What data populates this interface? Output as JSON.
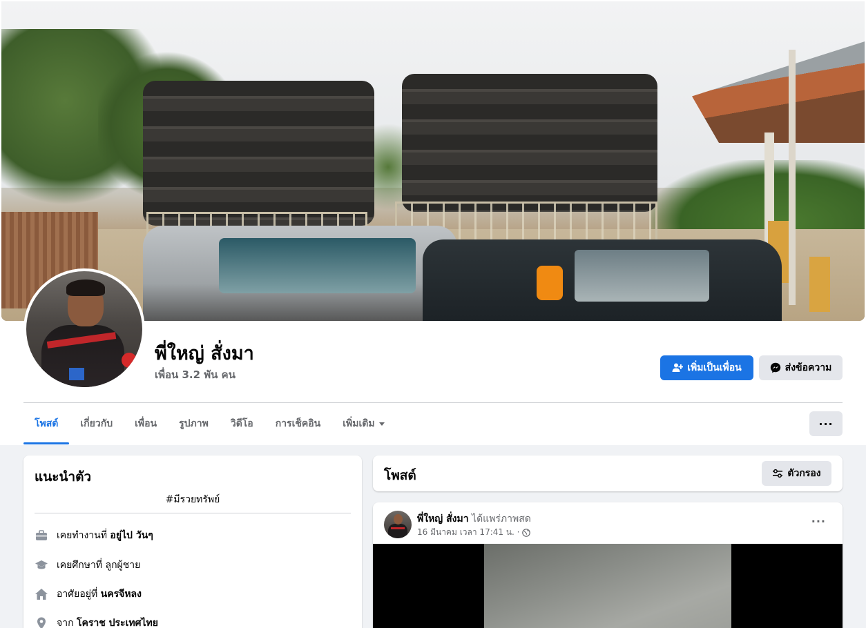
{
  "profile": {
    "name": "พี่ใหญ่ สั่งมา",
    "friends": "เพื่อน 3.2 พัน คน"
  },
  "actions": {
    "add_friend": "เพิ่มเป็นเพื่อน",
    "message": "ส่งข้อความ",
    "more": "···"
  },
  "tabs": [
    {
      "label": "โพสต์",
      "active": true
    },
    {
      "label": "เกี่ยวกับ",
      "active": false
    },
    {
      "label": "เพื่อน",
      "active": false
    },
    {
      "label": "รูปภาพ",
      "active": false
    },
    {
      "label": "วิดีโอ",
      "active": false
    },
    {
      "label": "การเช็คอิน",
      "active": false
    },
    {
      "label": "เพิ่มเติม",
      "active": false
    }
  ],
  "intro": {
    "title": "แนะนำตัว",
    "bio": "#มีรวยทรัพย์",
    "items": [
      {
        "icon": "briefcase-icon",
        "prefix": "เคยทำงานที่",
        "value": "อยู่ไป วันๆ"
      },
      {
        "icon": "graduation-cap-icon",
        "prefix": "เคยศึกษาที่ ลูกผู้ชาย",
        "value": ""
      },
      {
        "icon": "home-icon",
        "prefix": "อาศัยอยู่ที่",
        "value": "นครจีหลง"
      },
      {
        "icon": "location-pin-icon",
        "prefix": "จาก",
        "value": "โคราช ประเทศไทย"
      }
    ]
  },
  "posts": {
    "title": "โพสต์",
    "filter_label": "ตัวกรอง",
    "items": [
      {
        "author": "พี่ใหญ่ สั่งมา",
        "action": "ได้แพร่ภาพสด",
        "timestamp": "16 มีนาคม เวลา 17:41 น. ·",
        "privacy_icon": "globe-icon",
        "more": "···"
      }
    ]
  },
  "colors": {
    "accent": "#1b74e4",
    "background": "#f0f2f5",
    "secondary_button": "#e4e6eb",
    "muted_text": "#65676b"
  }
}
